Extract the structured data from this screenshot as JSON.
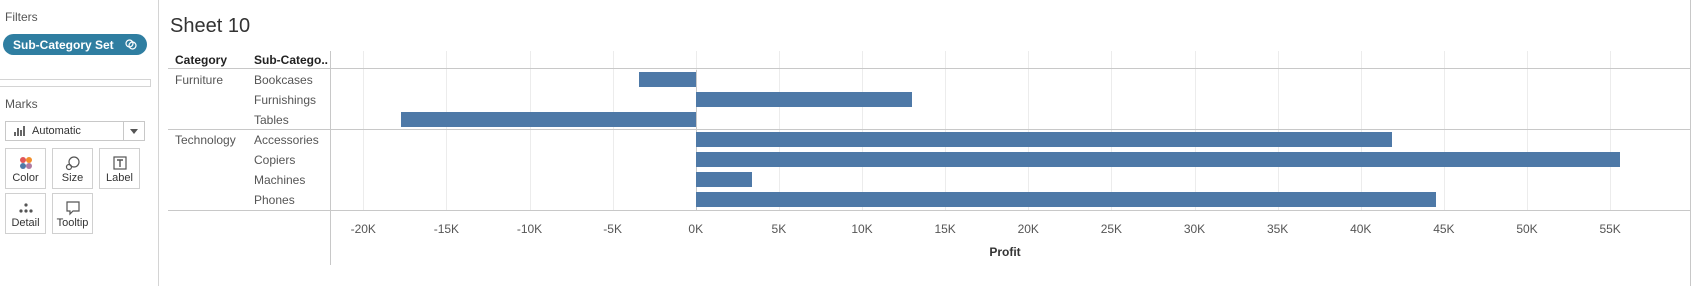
{
  "filters": {
    "title": "Filters",
    "pill_label": "Sub-Category Set"
  },
  "marks": {
    "title": "Marks",
    "type_label": "Automatic",
    "buttons": [
      "Color",
      "Size",
      "Label",
      "Detail",
      "Tooltip"
    ]
  },
  "sheet": {
    "title": "Sheet 10",
    "header_category": "Category",
    "header_subcategory": "Sub-Catego.."
  },
  "colors": {
    "bar": "#4e79a7",
    "pill": "#2f7ea1"
  },
  "chart_data": {
    "type": "bar",
    "orientation": "horizontal",
    "xlabel": "Profit",
    "xlim": [
      -22000,
      58000
    ],
    "x_ticks": [
      "-20K",
      "-15K",
      "-10K",
      "-5K",
      "0K",
      "5K",
      "10K",
      "15K",
      "20K",
      "25K",
      "30K",
      "35K",
      "40K",
      "45K",
      "50K",
      "55K"
    ],
    "groups": [
      {
        "category": "Furniture",
        "rows": [
          {
            "subcategory": "Bookcases",
            "value": -3400
          },
          {
            "subcategory": "Furnishings",
            "value": 13000
          },
          {
            "subcategory": "Tables",
            "value": -17700
          }
        ]
      },
      {
        "category": "Technology",
        "rows": [
          {
            "subcategory": "Accessories",
            "value": 41900
          },
          {
            "subcategory": "Copiers",
            "value": 55600
          },
          {
            "subcategory": "Machines",
            "value": 3400
          },
          {
            "subcategory": "Phones",
            "value": 44500
          }
        ]
      }
    ]
  }
}
